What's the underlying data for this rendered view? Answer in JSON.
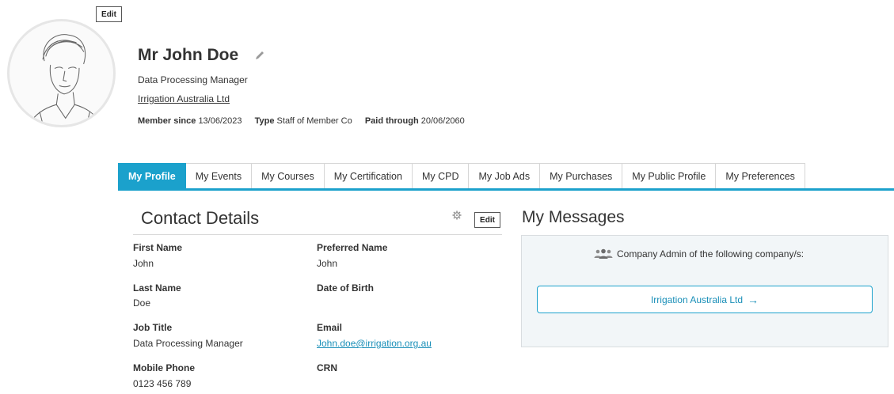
{
  "profile": {
    "edit_label": "Edit",
    "name": "Mr John Doe",
    "job_title": "Data Processing Manager",
    "company": "Irrigation Australia Ltd",
    "member_since_label": "Member since",
    "member_since": "13/06/2023",
    "type_label": "Type",
    "type": "Staff of Member Co",
    "paid_through_label": "Paid through",
    "paid_through": "20/06/2060"
  },
  "tabs": [
    {
      "label": "My Profile",
      "active": true
    },
    {
      "label": "My Events"
    },
    {
      "label": "My Courses"
    },
    {
      "label": "My Certification"
    },
    {
      "label": "My CPD"
    },
    {
      "label": "My Job Ads"
    },
    {
      "label": "My Purchases"
    },
    {
      "label": "My Public Profile"
    },
    {
      "label": "My Preferences"
    }
  ],
  "contact": {
    "title": "Contact Details",
    "edit_label": "Edit",
    "fields": [
      {
        "label": "First Name",
        "value": "John"
      },
      {
        "label": "Preferred Name",
        "value": "John"
      },
      {
        "label": "Last Name",
        "value": "Doe"
      },
      {
        "label": "Date of Birth",
        "value": ""
      },
      {
        "label": "Job Title",
        "value": "Data Processing Manager"
      },
      {
        "label": "Email",
        "value": "John.doe@irrigation.org.au"
      },
      {
        "label": "Mobile Phone",
        "value": "0123 456 789"
      },
      {
        "label": "CRN",
        "value": ""
      }
    ]
  },
  "messages": {
    "title": "My Messages",
    "company_admin_text": "Company Admin of the following company/s:",
    "company_button": "Irrigation Australia Ltd",
    "arrow": "→"
  },
  "colors": {
    "accent": "#1ba1cc",
    "link": "#1a8fb8"
  }
}
